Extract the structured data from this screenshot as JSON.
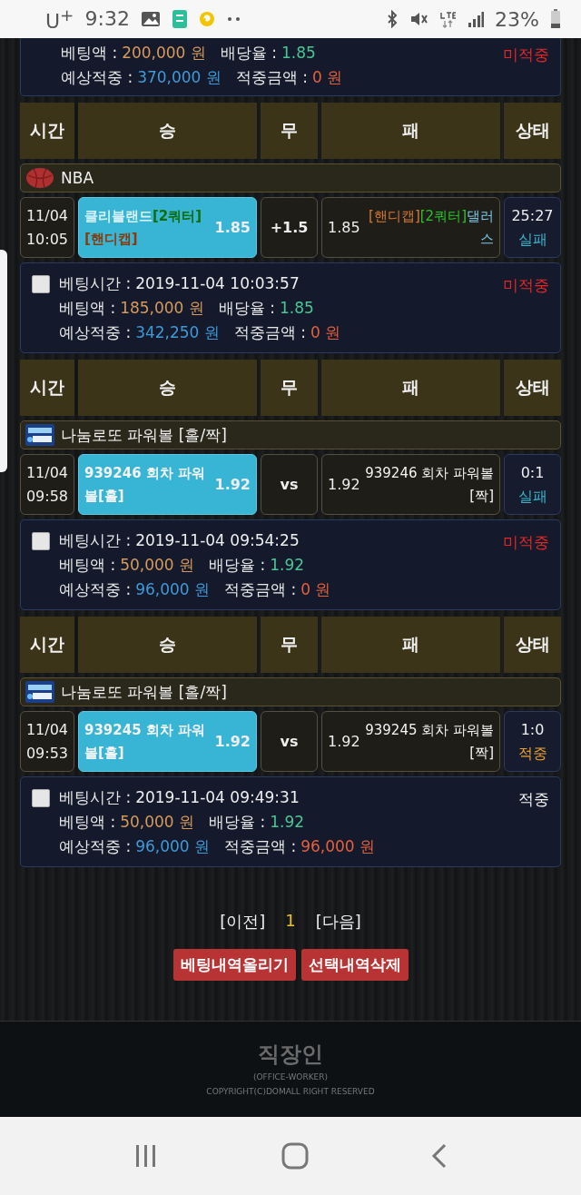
{
  "status_bar": {
    "carrier": "U$^{+}$",
    "time": "9:32",
    "battery": "23%"
  },
  "partial_bet": {
    "lines": [
      [
        {
          "label": "베팅액 :",
          "value": "200,000 원",
          "kind": "amount"
        },
        {
          "label": "배당율 :",
          "value": "1.85",
          "kind": "odds"
        }
      ],
      [
        {
          "label": "예상적중 :",
          "value": "370,000 원",
          "kind": "expected"
        },
        {
          "label": "적중금액 :",
          "value": "0 원",
          "kind": "win"
        }
      ]
    ],
    "result": {
      "text": "미적중",
      "kind": "miss"
    }
  },
  "sections": [
    {
      "columns": [
        "시간",
        "승",
        "무",
        "패",
        "상태"
      ],
      "league": {
        "name": "NBA",
        "kind": "basketball"
      },
      "match": {
        "date": "11/04",
        "time": "10:05",
        "home": {
          "segments": [
            {
              "text": "클리블랜드",
              "kind": "team"
            },
            {
              "text": "[2쿼터]",
              "kind": "period"
            },
            {
              "text": "[핸디캡]",
              "kind": "handicap"
            }
          ],
          "odds": "1.85",
          "selected": true
        },
        "draw": "+1.5",
        "away": {
          "odds": "1.85",
          "segments": [
            {
              "text": "[핸디캡]",
              "kind": "handicap"
            },
            {
              "text": "[2쿼터]",
              "kind": "period"
            },
            {
              "text": "댈러스",
              "kind": "team"
            }
          ],
          "selected": false
        },
        "score": "25:27",
        "outcome": {
          "text": "실패",
          "kind": "lose"
        }
      },
      "bet": {
        "checked": false,
        "lines": [
          [
            {
              "label": "베팅시간 :",
              "value": "2019-11-04 10:03:57",
              "kind": "time"
            }
          ],
          [
            {
              "label": "베팅액 :",
              "value": "185,000 원",
              "kind": "amount"
            },
            {
              "label": "배당율 :",
              "value": "1.85",
              "kind": "odds"
            }
          ],
          [
            {
              "label": "예상적중 :",
              "value": "342,250 원",
              "kind": "expected"
            },
            {
              "label": "적중금액 :",
              "value": "0 원",
              "kind": "win"
            }
          ]
        ],
        "result": {
          "text": "미적중",
          "kind": "miss"
        }
      }
    },
    {
      "columns": [
        "시간",
        "승",
        "무",
        "패",
        "상태"
      ],
      "league": {
        "name": "나눔로또 파워볼 [홀/짝]",
        "kind": "powerball"
      },
      "match": {
        "date": "11/04",
        "time": "09:58",
        "home": {
          "segments": [
            {
              "text": "939246 회차 파워볼[홀]",
              "kind": "plain"
            }
          ],
          "odds": "1.92",
          "selected": true
        },
        "draw": "vs",
        "away": {
          "odds": "1.92",
          "segments": [
            {
              "text": "939246 회차 파워볼[짝]",
              "kind": "plain"
            }
          ],
          "selected": false
        },
        "score": "0:1",
        "outcome": {
          "text": "실패",
          "kind": "lose"
        }
      },
      "bet": {
        "checked": false,
        "lines": [
          [
            {
              "label": "베팅시간 :",
              "value": "2019-11-04 09:54:25",
              "kind": "time"
            }
          ],
          [
            {
              "label": "베팅액 :",
              "value": "50,000 원",
              "kind": "amount"
            },
            {
              "label": "배당율 :",
              "value": "1.92",
              "kind": "odds"
            }
          ],
          [
            {
              "label": "예상적중 :",
              "value": "96,000 원",
              "kind": "expected"
            },
            {
              "label": "적중금액 :",
              "value": "0 원",
              "kind": "win"
            }
          ]
        ],
        "result": {
          "text": "미적중",
          "kind": "miss"
        }
      }
    },
    {
      "columns": [
        "시간",
        "승",
        "무",
        "패",
        "상태"
      ],
      "league": {
        "name": "나눔로또 파워볼 [홀/짝]",
        "kind": "powerball"
      },
      "match": {
        "date": "11/04",
        "time": "09:53",
        "home": {
          "segments": [
            {
              "text": "939245 회차 파워볼[홀]",
              "kind": "plain"
            }
          ],
          "odds": "1.92",
          "selected": true
        },
        "draw": "vs",
        "away": {
          "odds": "1.92",
          "segments": [
            {
              "text": "939245 회차 파워볼[짝]",
              "kind": "plain"
            }
          ],
          "selected": false
        },
        "score": "1:0",
        "outcome": {
          "text": "적중",
          "kind": "win"
        }
      },
      "bet": {
        "checked": false,
        "lines": [
          [
            {
              "label": "베팅시간 :",
              "value": "2019-11-04 09:49:31",
              "kind": "time"
            }
          ],
          [
            {
              "label": "베팅액 :",
              "value": "50,000 원",
              "kind": "amount"
            },
            {
              "label": "배당율 :",
              "value": "1.92",
              "kind": "odds"
            }
          ],
          [
            {
              "label": "예상적중 :",
              "value": "96,000 원",
              "kind": "expected"
            },
            {
              "label": "적중금액 :",
              "value": "96,000 원",
              "kind": "win"
            }
          ]
        ],
        "result": {
          "text": "적중",
          "kind": "hit"
        }
      }
    }
  ],
  "pagination": {
    "prev": "[이전]",
    "page": "1",
    "next": "[다음]"
  },
  "buttons": [
    "베팅내역올리기",
    "선택내역삭제"
  ],
  "footer": {
    "brand": "직장인",
    "subtitle": "(OFFICE-WORKER)",
    "copyright": "COPYRIGHT(C)DOMALL RIGHT RESERVED"
  }
}
